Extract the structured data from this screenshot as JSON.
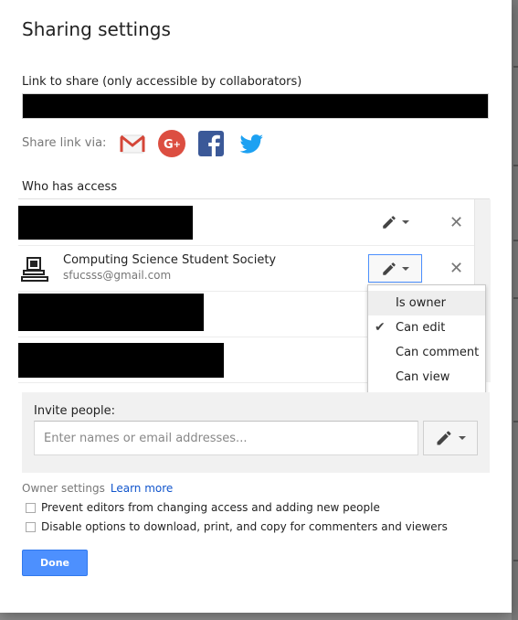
{
  "dialog": {
    "title": "Sharing settings",
    "link_label": "Link to share (only accessible by collaborators)",
    "share_via_label": "Share link via:",
    "share_icons": [
      "gmail-icon",
      "google-plus-icon",
      "facebook-icon",
      "twitter-icon"
    ],
    "who_has_access_label": "Who has access"
  },
  "collaborator": {
    "name": "Computing Science Student Society",
    "email": "sfucsss@gmail.com",
    "icon": "computer-icon"
  },
  "permission_menu": {
    "items": [
      "Is owner",
      "Can edit",
      "Can comment",
      "Can view"
    ],
    "selected": "Can edit",
    "hovered": "Is owner"
  },
  "invite": {
    "label": "Invite people:",
    "placeholder": "Enter names or email addresses..."
  },
  "owner_settings": {
    "label": "Owner settings",
    "learn_more": "Learn more",
    "option_prevent_editors": "Prevent editors from changing access and adding new people",
    "option_disable_download": "Disable options to download, print, and copy for commenters and viewers"
  },
  "done_label": "Done",
  "colors": {
    "accent_blue": "#4d90fe",
    "link_blue": "#1155cc",
    "gmail_red": "#d44638",
    "gplus_red": "#dc4e41",
    "facebook_blue": "#3b5998",
    "twitter_blue": "#1da1f2"
  }
}
